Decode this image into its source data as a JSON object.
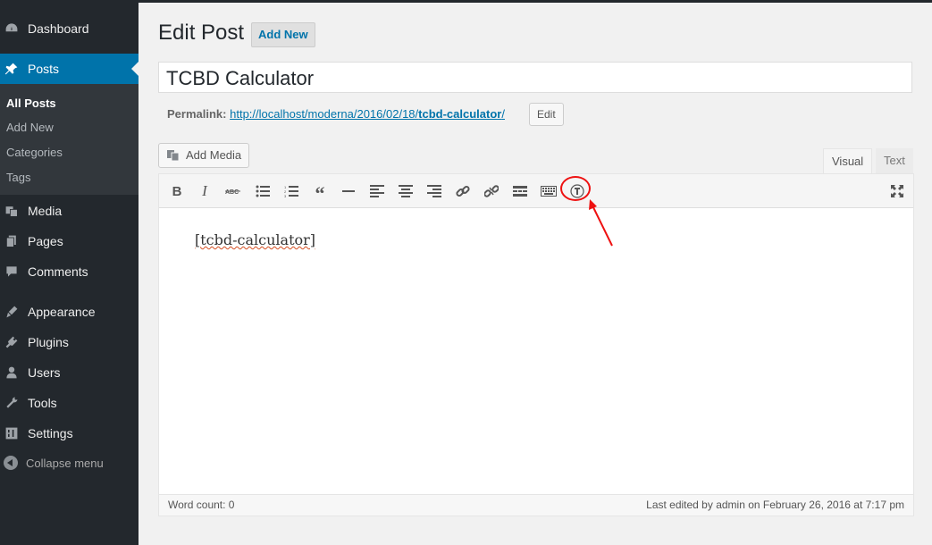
{
  "sidebar": {
    "items": [
      {
        "label": "Dashboard",
        "icon": "dashboard-icon"
      },
      {
        "label": "Posts",
        "icon": "pushpin-icon"
      },
      {
        "label": "Media",
        "icon": "media-icon"
      },
      {
        "label": "Pages",
        "icon": "pages-icon"
      },
      {
        "label": "Comments",
        "icon": "comments-icon"
      },
      {
        "label": "Appearance",
        "icon": "appearance-icon"
      },
      {
        "label": "Plugins",
        "icon": "plugins-icon"
      },
      {
        "label": "Users",
        "icon": "users-icon"
      },
      {
        "label": "Tools",
        "icon": "tools-icon"
      },
      {
        "label": "Settings",
        "icon": "settings-icon"
      }
    ],
    "submenu": [
      "All Posts",
      "Add New",
      "Categories",
      "Tags"
    ],
    "collapse_label": "Collapse menu"
  },
  "header": {
    "title": "Edit Post",
    "add_new": "Add New"
  },
  "post": {
    "title": "TCBD Calculator",
    "permalink_label": "Permalink:",
    "permalink_base": "http://localhost/moderna/2016/02/18/",
    "permalink_slug": "tcbd-calculator",
    "permalink_trail": "/",
    "edit_label": "Edit"
  },
  "editor": {
    "add_media": "Add Media",
    "tabs": {
      "visual": "Visual",
      "text": "Text"
    },
    "content": "[tcbd-calculator]",
    "word_count": "Word count: 0",
    "last_edited": "Last edited by admin on February 26, 2016 at 7:17 pm"
  },
  "colors": {
    "sidebar_bg": "#23282d",
    "accent": "#0073aa",
    "annotation": "#e11111"
  }
}
